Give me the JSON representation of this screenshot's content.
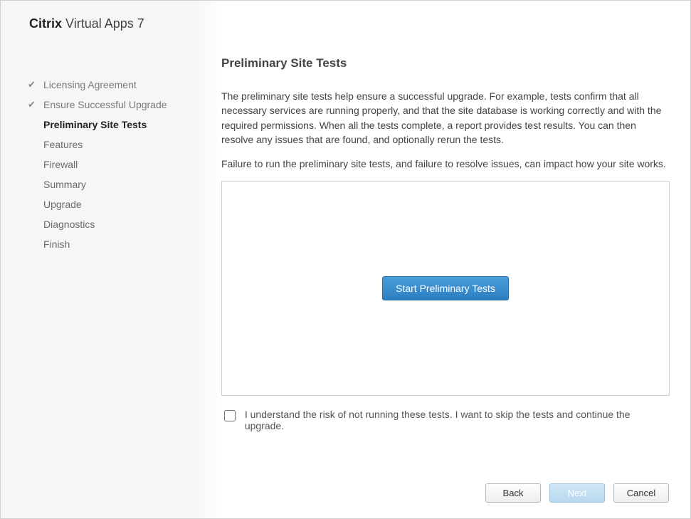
{
  "header": {
    "brand": "Citrix",
    "product": "Virtual Apps 7"
  },
  "sidebar": {
    "items": [
      {
        "label": "Licensing Agreement",
        "state": "completed"
      },
      {
        "label": "Ensure Successful Upgrade",
        "state": "completed"
      },
      {
        "label": "Preliminary Site Tests",
        "state": "current"
      },
      {
        "label": "Features",
        "state": "pending"
      },
      {
        "label": "Firewall",
        "state": "pending"
      },
      {
        "label": "Summary",
        "state": "pending"
      },
      {
        "label": "Upgrade",
        "state": "pending"
      },
      {
        "label": "Diagnostics",
        "state": "pending"
      },
      {
        "label": "Finish",
        "state": "pending"
      }
    ]
  },
  "main": {
    "title": "Preliminary Site Tests",
    "paragraph1": "The preliminary site tests help ensure a successful upgrade. For example, tests confirm that all necessary services are running properly, and that the site database is working correctly and with the required permissions. When all the tests complete, a report provides test results. You can then resolve any issues that are found, and optionally rerun the tests.",
    "paragraph2": "Failure to run the preliminary site tests, and failure to resolve issues, can impact how your site works.",
    "start_button": "Start Preliminary Tests",
    "ack_label": "I understand the risk of not running these tests. I want to skip the tests and continue the upgrade.",
    "ack_checked": false
  },
  "footer": {
    "back": "Back",
    "next": "Next",
    "cancel": "Cancel",
    "next_enabled": false
  }
}
